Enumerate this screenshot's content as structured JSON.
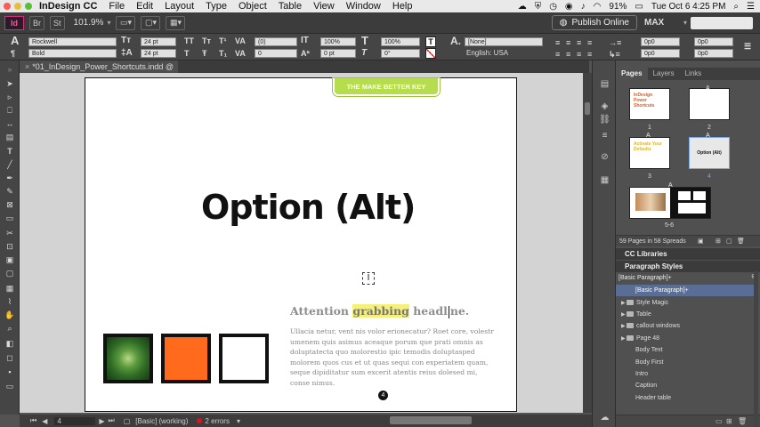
{
  "menubar": {
    "app_name": "InDesign CC",
    "items": [
      "File",
      "Edit",
      "Layout",
      "Type",
      "Object",
      "Table",
      "View",
      "Window",
      "Help"
    ],
    "battery": "91%",
    "clock": "Tue Oct 6  4:25 PM"
  },
  "appbar": {
    "logo": "Id",
    "bridge": "Br",
    "stock": "St",
    "zoom": "101.9%",
    "publish_label": "Publish Online",
    "workspace": "MAX"
  },
  "control": {
    "font_family": "Rockwell",
    "font_style": "Bold",
    "font_size": "24 pt",
    "leading": "24 pt",
    "kerning": "(0)",
    "tracking": "0",
    "vscale": "100%",
    "hscale": "100%",
    "baseline": "0 pt",
    "skew": "0°",
    "char_style": "[None]",
    "language": "English: USA",
    "r1": "0p0",
    "r2": "0p0",
    "r3": "0p0",
    "r4": "0p0"
  },
  "document": {
    "tab_title": "*01_InDesign_Power_Shortcuts.indd @ 102%",
    "top_badge": "THE MAKE BETTER KEY",
    "headline": "Option (Alt)",
    "attention_pre": "Attention ",
    "attention_hl": "grabbing",
    "attention_mid": " headl",
    "attention_post": "ne.",
    "body_text": "Ullacia netur, vent nis volor erionecatur? Roet core, volestr umenem quis asimus aceaque porum que prati omnis as doluptatecta quo molorestio ipic temodis doluptasped molorem quos cus et ut quas sequi con experiatem quam, seque dipiditatur sum excerit atentis reius dolesed mi, conse nimus.",
    "page_number": "4"
  },
  "statusbar": {
    "page": "4",
    "style": "[Basic] (working)",
    "errors": "2 errors"
  },
  "pages_panel": {
    "tabs": [
      "Pages",
      "Layers",
      "Links"
    ],
    "thumb_labels": [
      "1",
      "2",
      "3",
      "4",
      "5-6"
    ],
    "thumb1_text": "InDesign Power Shortcuts",
    "thumb3_text": "Activate Your Defaults",
    "thumb4_text": "Option (Alt)",
    "master_a": "A",
    "footer": "59 Pages in 58 Spreads"
  },
  "libraries": {
    "title": "CC Libraries"
  },
  "para_styles": {
    "title": "Paragraph Styles",
    "current": "[Basic Paragraph]+",
    "items": [
      {
        "label": "[Basic Paragraph]+",
        "type": "style",
        "selected": true
      },
      {
        "label": "Style Magic",
        "type": "folder"
      },
      {
        "label": "Table",
        "type": "folder"
      },
      {
        "label": "callout windows",
        "type": "folder"
      },
      {
        "label": "Page 48",
        "type": "folder"
      },
      {
        "label": "Body Text",
        "type": "style"
      },
      {
        "label": "Body First",
        "type": "style"
      },
      {
        "label": "Intro",
        "type": "style"
      },
      {
        "label": "Caption",
        "type": "style"
      },
      {
        "label": "Header table",
        "type": "style"
      }
    ]
  },
  "colors": {
    "accent_green": "#b6dd4d",
    "orange": "#ff6a1c",
    "indesign_pink": "#f25aa0",
    "selection_blue": "#5a6e95"
  }
}
